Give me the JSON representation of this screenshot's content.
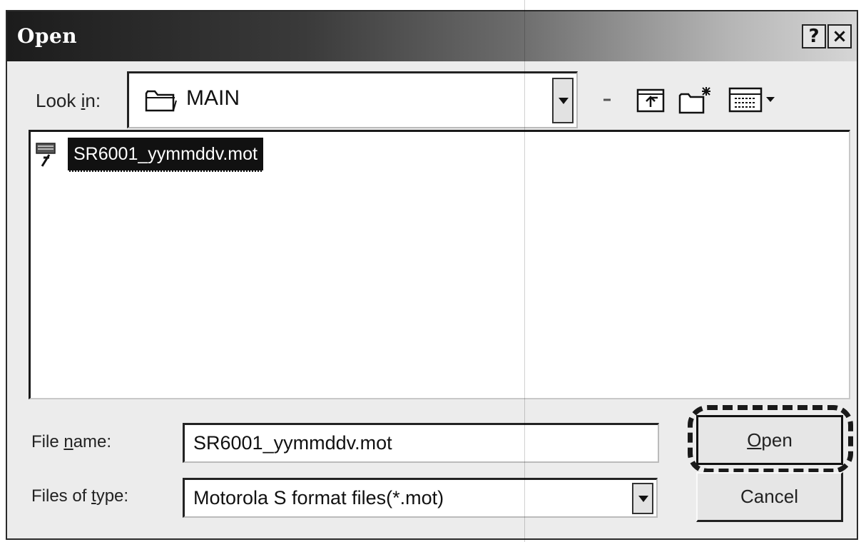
{
  "window": {
    "title": "Open",
    "help_label": "?",
    "close_label": "×"
  },
  "lookin": {
    "label_prefix": "Look ",
    "label_accel": "i",
    "label_suffix": "n:",
    "value": "MAIN",
    "folder_icon": "folder-icon",
    "toolbar_icons": [
      "back-icon",
      "up-one-level-icon",
      "new-folder-icon",
      "view-menu-icon"
    ]
  },
  "file_list": {
    "items": [
      {
        "name": "SR6001_yymmddv.mot",
        "icon": "mot-file-icon",
        "selected": true
      }
    ]
  },
  "filename": {
    "label_prefix": "File ",
    "label_accel": "n",
    "label_suffix": "ame:",
    "value": "SR6001_yymmddv.mot"
  },
  "filetype": {
    "label_prefix": "Files of ",
    "label_accel": "t",
    "label_suffix": "ype:",
    "value": "Motorola S format files(*.mot)"
  },
  "buttons": {
    "open_accel": "O",
    "open_rest": "pen",
    "cancel_label": "Cancel"
  },
  "colors": {
    "title_gradient_start": "#1c1c1c",
    "title_gradient_end": "#d6d6d6",
    "selection_bg": "#111111",
    "dialog_bg": "#ececec"
  }
}
